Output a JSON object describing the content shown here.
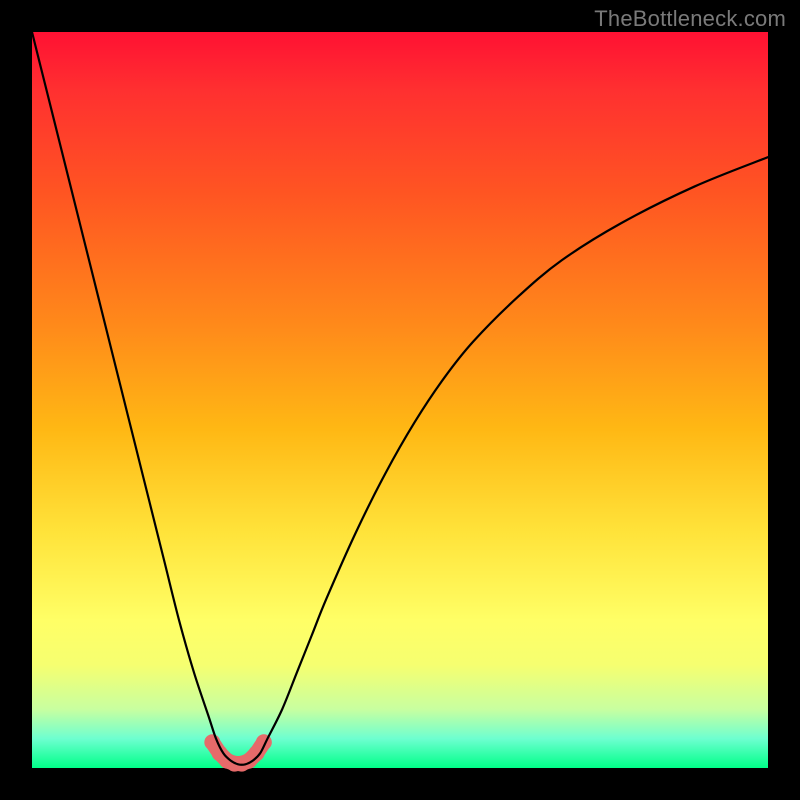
{
  "watermark": "TheBottleneck.com",
  "chart_data": {
    "type": "line",
    "title": "",
    "xlabel": "",
    "ylabel": "",
    "xlim": [
      0,
      100
    ],
    "ylim": [
      0,
      100
    ],
    "series": [
      {
        "name": "bottleneck-curve",
        "x": [
          0,
          2,
          4,
          6,
          8,
          10,
          12,
          14,
          16,
          18,
          20,
          22,
          24,
          25,
          26,
          27,
          28,
          29,
          30,
          31,
          32,
          34,
          36,
          38,
          40,
          44,
          48,
          52,
          56,
          60,
          66,
          72,
          80,
          90,
          100
        ],
        "y": [
          100,
          92,
          84,
          76,
          68,
          60,
          52,
          44,
          36,
          28,
          20,
          13,
          7,
          4,
          2,
          1,
          0.5,
          0.5,
          1,
          2,
          4,
          8,
          13,
          18,
          23,
          32,
          40,
          47,
          53,
          58,
          64,
          69,
          74,
          79,
          83
        ]
      }
    ],
    "marker_region": {
      "name": "optimal-range",
      "x": [
        24.5,
        25.5,
        26.5,
        27.5,
        28.5,
        29.5,
        30.5,
        31.5
      ],
      "y": [
        3.5,
        2,
        1,
        0.6,
        0.6,
        1,
        2,
        3.5
      ],
      "color": "#e66a6a",
      "radius": 8
    },
    "gradient_stops": [
      {
        "pos": 0,
        "color": "#ff1133"
      },
      {
        "pos": 8,
        "color": "#ff3030"
      },
      {
        "pos": 22,
        "color": "#ff5522"
      },
      {
        "pos": 40,
        "color": "#ff8a1a"
      },
      {
        "pos": 54,
        "color": "#ffb814"
      },
      {
        "pos": 68,
        "color": "#ffe33a"
      },
      {
        "pos": 80,
        "color": "#ffff66"
      },
      {
        "pos": 86,
        "color": "#f6ff70"
      },
      {
        "pos": 92,
        "color": "#c8ffa0"
      },
      {
        "pos": 96,
        "color": "#6effd0"
      },
      {
        "pos": 100,
        "color": "#00ff88"
      }
    ]
  }
}
